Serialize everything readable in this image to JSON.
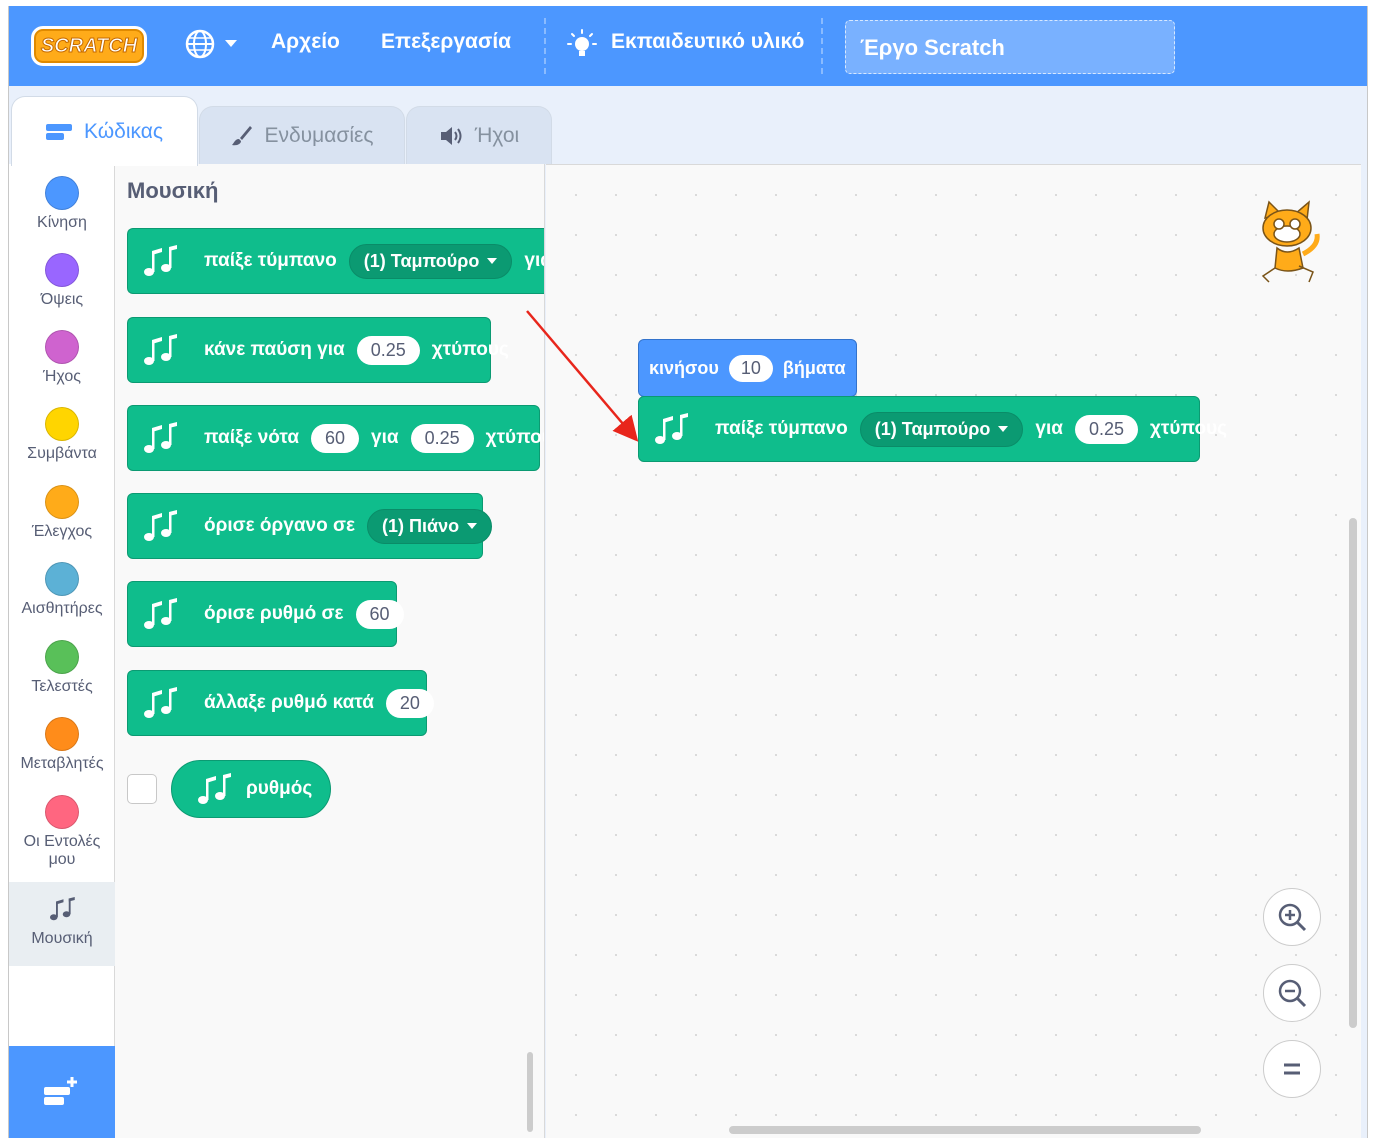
{
  "menubar": {
    "logo": "SCRATCH",
    "language_icon": "globe-icon",
    "file": "Αρχείο",
    "edit": "Επεξεργασία",
    "tutorials": "Εκπαιδευτικό υλικό",
    "project_title": "Έργο Scratch",
    "color": "#4c97ff"
  },
  "tabs": [
    {
      "label": "Κώδικας",
      "icon": "code-icon"
    },
    {
      "label": "Ενδυμασίες",
      "icon": "brush-icon"
    },
    {
      "label": "Ήχοι",
      "icon": "speaker-icon"
    }
  ],
  "categories": [
    {
      "label": "Κίνηση",
      "color": "#4c97ff"
    },
    {
      "label": "Όψεις",
      "color": "#9966ff"
    },
    {
      "label": "Ήχος",
      "color": "#cf63cf"
    },
    {
      "label": "Συμβάντα",
      "color": "#ffd500"
    },
    {
      "label": "Έλεγχος",
      "color": "#ffab19"
    },
    {
      "label": "Αισθητήρες",
      "color": "#5cb1d6"
    },
    {
      "label": "Τελεστές",
      "color": "#59c059"
    },
    {
      "label": "Μεταβλητές",
      "color": "#ff8c1a"
    },
    {
      "label": "Οι Εντολές μου",
      "color": "#ff6680"
    },
    {
      "label": "Μουσική",
      "icon": "music-notes-icon"
    }
  ],
  "palette": {
    "title": "Μουσική",
    "play_drum": {
      "text1": "παίξε τύμπανο",
      "dropdown": "(1) Ταμπούρο",
      "text2": "για"
    },
    "rest": {
      "text1": "κάνε παύση για",
      "value": "0.25",
      "text2": "χτύπους"
    },
    "play_note": {
      "text1": "παίξε νότα",
      "value1": "60",
      "text2": "για",
      "value2": "0.25",
      "text3": "χτύπους"
    },
    "set_instrument": {
      "text1": "όρισε όργανο σε",
      "dropdown": "(1) Πιάνο"
    },
    "set_tempo": {
      "text1": "όρισε ρυθμό σε",
      "value": "60"
    },
    "change_tempo": {
      "text1": "άλλαξε ρυθμό κατά",
      "value": "20"
    },
    "tempo_reporter": {
      "text": "ρυθμός"
    }
  },
  "workspace": {
    "motion_block": {
      "text1": "κινήσου",
      "value": "10",
      "text2": "βήματα"
    },
    "drum_block": {
      "text1": "παίξε τύμπανο",
      "dropdown": "(1) Ταμπούρο",
      "text2": "για",
      "value": "0.25",
      "text3": "χτύπους"
    },
    "music_color": "#0fbd8c",
    "annotation_arrow_color": "#e8261c"
  }
}
